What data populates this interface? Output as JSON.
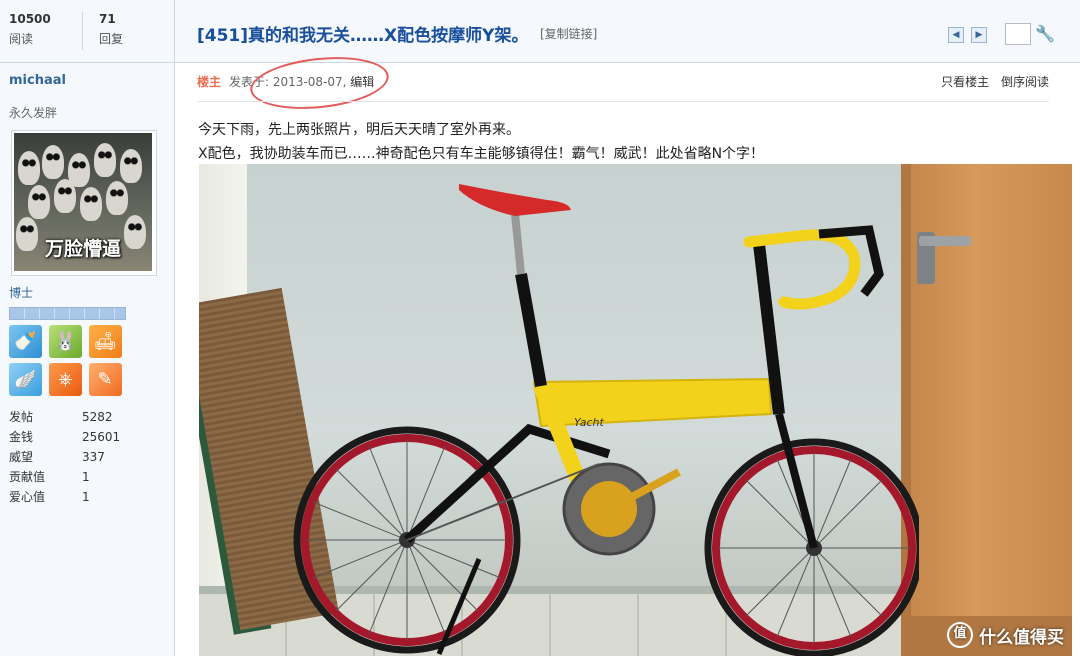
{
  "thread": {
    "views": "10500",
    "views_label": "阅读",
    "replies": "71",
    "replies_label": "回复",
    "title": "[451]真的和我无关……X配色按摩师Y架。",
    "copy_link": "[复制链接]"
  },
  "author": {
    "name": "michaal",
    "user_title": "永久发胖",
    "avatar_caption": "万脸懵逼",
    "rank": "博士",
    "stats": [
      {
        "label": "发帖",
        "value": "5282"
      },
      {
        "label": "金钱",
        "value": "25601"
      },
      {
        "label": "威望",
        "value": "337"
      },
      {
        "label": "贡献值",
        "value": "1"
      },
      {
        "label": "爱心值",
        "value": "1"
      }
    ],
    "medal_icons": [
      "baby-bottle-medal-icon",
      "bunny-medal-icon",
      "sofa-medal-icon",
      "wing-medal-icon",
      "wheel-medal-icon",
      "feather-medal-icon"
    ]
  },
  "post": {
    "op_badge": "楼主",
    "posted_at_prefix": "发表于: ",
    "posted_date": "2013-08-07",
    "edit_label": "编辑",
    "only_op": "只看楼主",
    "reverse_order": "倒序阅读",
    "line1": "今天下雨，先上两张照片，明后天天晴了室外再来。",
    "line2": "X配色，我协助装车而已……神奇配色只有车主能够镇得住！霸气！威武！此处省略N个字！",
    "frame_brand": "Yacht"
  },
  "watermark": {
    "icon": "值",
    "text": "什么值得买"
  },
  "colors": {
    "title_blue": "#1a4f9c",
    "op_orange": "#f26c4f",
    "annotation_red": "#e35b5b",
    "frame_yellow": "#f2d21a"
  }
}
